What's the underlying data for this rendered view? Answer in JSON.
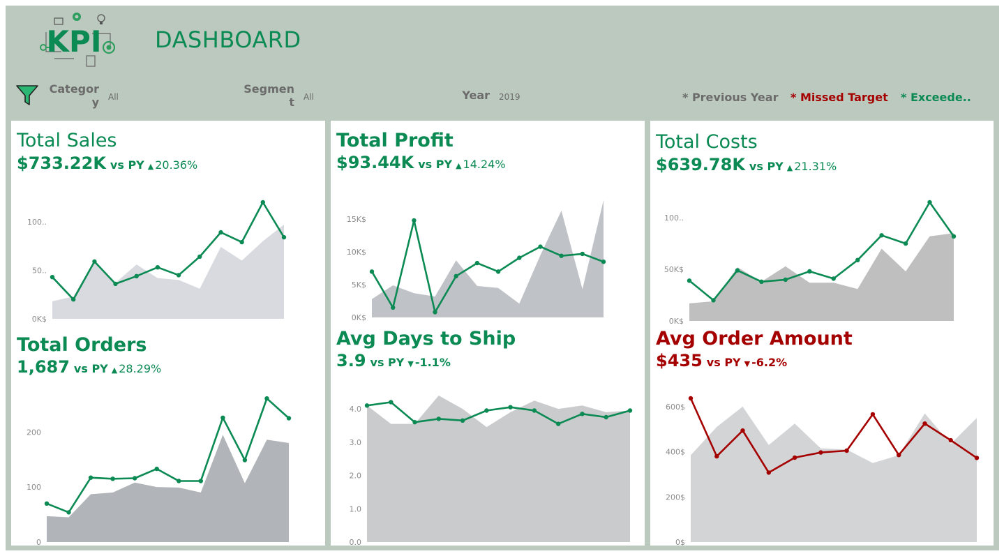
{
  "header": {
    "logo_text": "KPI",
    "title": "DASHBOARD"
  },
  "filters": {
    "category": {
      "label_line1": "Categor",
      "label_line2": "y",
      "value": "All"
    },
    "segment": {
      "label_line1": "Segmen",
      "label_line2": "t",
      "value": "All"
    },
    "year": {
      "label": "Year",
      "value": "2019"
    }
  },
  "legend": {
    "previous_year": "* Previous Year",
    "missed_target": "* Missed Target",
    "exceeded": "* Exceede..",
    "colors": {
      "previous_year": "#6b6b6b",
      "missed_target": "#a50000",
      "exceeded": "#0b8a54"
    }
  },
  "kpis": {
    "sales": {
      "title": "Total Sales",
      "value": "$733.22K",
      "vs": "vs  PY",
      "arrow": "▲",
      "change": "20.36%",
      "color": "#0b8a54"
    },
    "profit": {
      "title": "Total Profit",
      "value": "$93.44K",
      "vs": "vs PY",
      "arrow": "▲",
      "change": "14.24%",
      "color": "#0b8a54"
    },
    "costs": {
      "title": "Total Costs",
      "value": "$639.78K",
      "vs": "vs  PY",
      "arrow": "▲",
      "change": "21.31%",
      "color": "#0b8a54"
    },
    "orders": {
      "title": "Total Orders",
      "value": "1,687",
      "vs": "vs PY",
      "arrow": "▲",
      "change": "28.29%",
      "color": "#0b8a54"
    },
    "ship": {
      "title": "Avg Days to Ship",
      "value": "3.9",
      "vs": "vs PY",
      "arrow": "▼",
      "change": "-1.1%",
      "color": "#0b8a54"
    },
    "aov": {
      "title": "Avg Order Amount",
      "value": "$435",
      "vs": "vs PY",
      "arrow": "▼",
      "change": "-6.2%",
      "color": "#a50000"
    }
  },
  "chart_data": [
    {
      "id": "sales",
      "type": "line",
      "ylim": [
        0,
        120
      ],
      "yticks": [
        0,
        50,
        100
      ],
      "ytick_labels": [
        "0K$",
        "50..",
        "100.."
      ],
      "series": [
        {
          "role": "current",
          "values": [
            43,
            20,
            59,
            36,
            44,
            53,
            45,
            64,
            89,
            79,
            120,
            84
          ]
        },
        {
          "role": "previous",
          "values": [
            18,
            23,
            60,
            37,
            56,
            42,
            40,
            31,
            74,
            60,
            80,
            97
          ]
        }
      ]
    },
    {
      "id": "profit",
      "type": "line",
      "ylim": [
        0,
        18000
      ],
      "yticks": [
        0,
        5000,
        10000,
        15000
      ],
      "ytick_labels": [
        "0K$",
        "5K$",
        "10K$",
        "15K$"
      ],
      "series": [
        {
          "role": "current",
          "values": [
            7000,
            1500,
            14800,
            800,
            6300,
            8300,
            7000,
            9100,
            10800,
            9400,
            9700,
            8500
          ]
        },
        {
          "role": "previous",
          "values": [
            2800,
            4900,
            3700,
            3200,
            8700,
            4800,
            4500,
            2100,
            9500,
            16300,
            4300,
            17900
          ]
        }
      ]
    },
    {
      "id": "costs",
      "type": "line",
      "ylim": [
        0,
        115
      ],
      "yticks": [
        0,
        50,
        100
      ],
      "ytick_labels": [
        "0K$",
        "50K$",
        "100.."
      ],
      "series": [
        {
          "role": "current",
          "values": [
            39,
            20,
            49,
            38,
            40,
            48,
            41,
            59,
            83,
            75,
            115,
            82
          ]
        },
        {
          "role": "previous",
          "values": [
            17,
            19,
            52,
            38,
            53,
            37,
            37,
            31,
            70,
            48,
            82,
            85
          ]
        }
      ]
    },
    {
      "id": "orders",
      "type": "line",
      "ylim": [
        0,
        265
      ],
      "yticks": [
        0,
        100,
        200
      ],
      "ytick_labels": [
        "0",
        "100",
        "200"
      ],
      "series": [
        {
          "role": "current",
          "values": [
            70,
            54,
            117,
            115,
            116,
            133,
            111,
            111,
            226,
            149,
            261,
            225
          ]
        },
        {
          "role": "previous",
          "values": [
            47,
            45,
            87,
            90,
            108,
            100,
            99,
            90,
            195,
            107,
            186,
            180
          ]
        }
      ]
    },
    {
      "id": "ship",
      "type": "line",
      "ylim": [
        0,
        4.4
      ],
      "yticks": [
        0,
        1,
        2,
        3,
        4
      ],
      "ytick_labels": [
        "0.0",
        "1.0",
        "2.0",
        "3.0",
        "4.0"
      ],
      "series": [
        {
          "role": "current",
          "values": [
            4.1,
            4.2,
            3.6,
            3.7,
            3.65,
            3.95,
            4.05,
            3.95,
            3.55,
            3.85,
            3.75,
            3.95
          ]
        },
        {
          "role": "previous",
          "values": [
            4.1,
            3.55,
            3.55,
            4.4,
            4.0,
            3.45,
            3.9,
            4.25,
            4.0,
            4.1,
            3.9,
            3.95
          ]
        }
      ]
    },
    {
      "id": "aov",
      "type": "line",
      "ylim": [
        0,
        640
      ],
      "yticks": [
        0,
        200,
        400,
        600
      ],
      "ytick_labels": [
        "0$",
        "200$",
        "400$",
        "600$"
      ],
      "series": [
        {
          "role": "current",
          "values": [
            637,
            380,
            494,
            308,
            374,
            397,
            405,
            566,
            386,
            525,
            451,
            373
          ]
        },
        {
          "role": "previous",
          "values": [
            385,
            510,
            600,
            430,
            525,
            415,
            410,
            350,
            385,
            570,
            435,
            550
          ]
        }
      ]
    }
  ]
}
